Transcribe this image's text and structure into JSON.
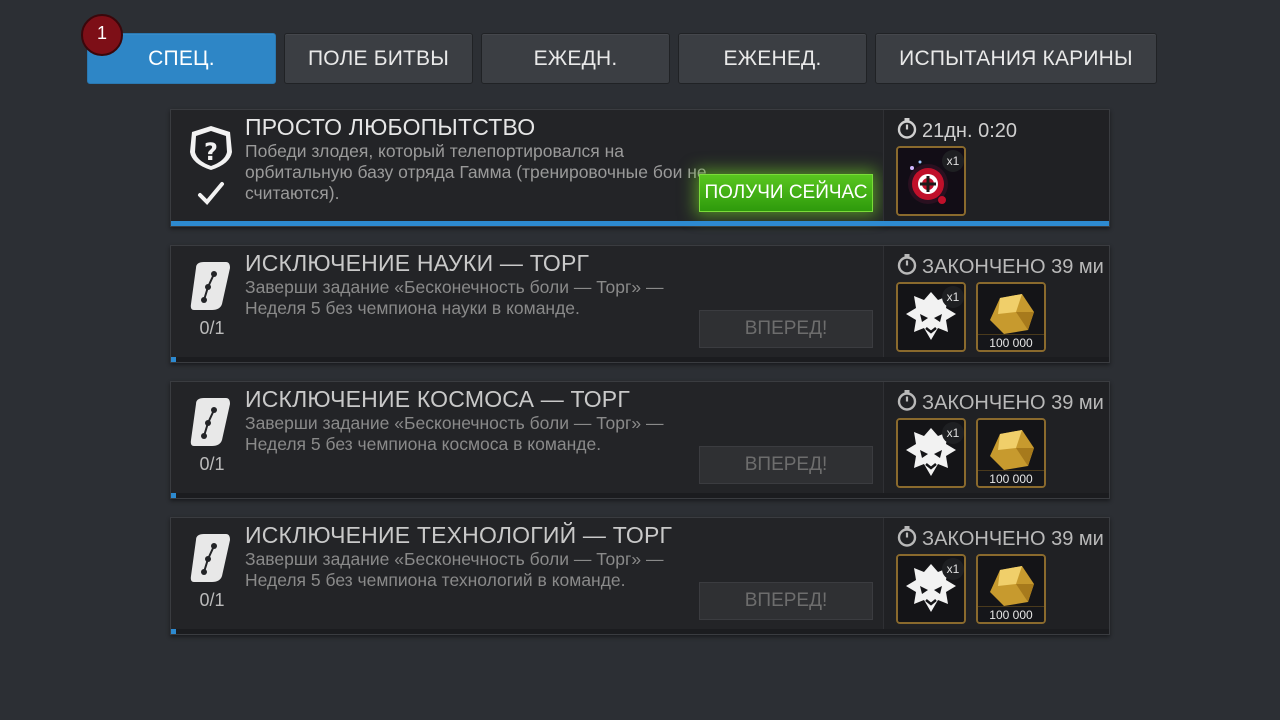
{
  "notification": {
    "count": "1"
  },
  "tabs": [
    {
      "label": "СПЕЦ.",
      "active": true
    },
    {
      "label": "ПОЛЕ БИТВЫ",
      "active": false
    },
    {
      "label": "ЕЖЕДН.",
      "active": false
    },
    {
      "label": "ЕЖЕНЕД.",
      "active": false
    },
    {
      "label": "ИСПЫТАНИЯ КАРИНЫ",
      "active": false
    }
  ],
  "quests": [
    {
      "title": "ПРОСТО ЛЮБОПЫТСТВО",
      "description": "Победи злодея, который телепортировался на орбитальную базу отряда Гамма (тренировочные бои не считаются).",
      "icon": "question-badge-icon",
      "status_icon": "checkmark-icon",
      "progress_text": "",
      "progress_fraction": 1.0,
      "button_label": "ПОЛУЧИ СЕЙЧАС",
      "button_state": "claim",
      "timer": "21дн. 0:20",
      "rewards": [
        {
          "icon": "crystal-orb-icon",
          "multiplier": "x1",
          "amount": ""
        }
      ]
    },
    {
      "title": "ИСКЛЮЧЕНИЕ НАУКИ — ТОРГ",
      "description": "Заверши задание «Бесконечность боли — Торг» — Неделя 5 без чемпиона науки в команде.",
      "icon": "scroll-quest-icon",
      "progress_text": "0/1",
      "progress_fraction": 0.0,
      "button_label": "ВПЕРЕД!",
      "button_state": "disabled",
      "timer": "ЗАКОНЧЕНО 39 ми",
      "rewards": [
        {
          "icon": "beast-mask-icon",
          "multiplier": "x1",
          "amount": ""
        },
        {
          "icon": "gold-nugget-icon",
          "multiplier": "",
          "amount": "100 000"
        }
      ]
    },
    {
      "title": "ИСКЛЮЧЕНИЕ КОСМОСА — ТОРГ",
      "description": "Заверши задание «Бесконечность боли — Торг» — Неделя 5 без чемпиона космоса в команде.",
      "icon": "scroll-quest-icon",
      "progress_text": "0/1",
      "progress_fraction": 0.0,
      "button_label": "ВПЕРЕД!",
      "button_state": "disabled",
      "timer": "ЗАКОНЧЕНО 39 ми",
      "rewards": [
        {
          "icon": "beast-mask-icon",
          "multiplier": "x1",
          "amount": ""
        },
        {
          "icon": "gold-nugget-icon",
          "multiplier": "",
          "amount": "100 000"
        }
      ]
    },
    {
      "title": "ИСКЛЮЧЕНИЕ ТЕХНОЛОГИЙ — ТОРГ",
      "description": "Заверши задание «Бесконечность боли — Торг» — Неделя 5 без чемпиона технологий в команде.",
      "icon": "scroll-quest-icon",
      "progress_text": "0/1",
      "progress_fraction": 0.0,
      "button_label": "ВПЕРЕД!",
      "button_state": "disabled",
      "timer": "ЗАКОНЧЕНО 39 ми",
      "rewards": [
        {
          "icon": "beast-mask-icon",
          "multiplier": "x1",
          "amount": ""
        },
        {
          "icon": "gold-nugget-icon",
          "multiplier": "",
          "amount": "100 000"
        }
      ]
    }
  ],
  "colors": {
    "background": "#2c2f34",
    "tab_active": "#2e86c6",
    "claim_button": "#3fae13",
    "progress": "#2d8ad0",
    "reward_border": "#8a6a2d"
  }
}
